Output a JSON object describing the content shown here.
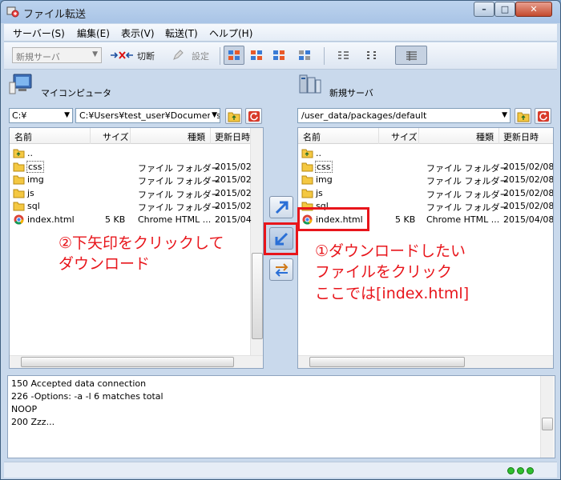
{
  "window": {
    "title": "ファイル転送"
  },
  "menu": [
    "サーバー(S)",
    "編集(E)",
    "表示(V)",
    "転送(T)",
    "ヘルプ(H)"
  ],
  "toolbar": {
    "server_select": "新規サーバ",
    "disconnect": "切断",
    "settings": "設定"
  },
  "local": {
    "label": "マイコンピュータ",
    "drive": "C:¥",
    "path": "C:¥Users¥test_user¥Documents",
    "columns": [
      "名前",
      "サイズ",
      "種類",
      "更新日時"
    ],
    "files": [
      {
        "name": "..",
        "size": "",
        "type": "",
        "date": "",
        "icon": "up-folder-icon"
      },
      {
        "name": "css",
        "size": "",
        "type": "ファイル フォルダー",
        "date": "2015/02",
        "icon": "folder-icon"
      },
      {
        "name": "img",
        "size": "",
        "type": "ファイル フォルダー",
        "date": "2015/02",
        "icon": "folder-icon"
      },
      {
        "name": "js",
        "size": "",
        "type": "ファイル フォルダー",
        "date": "2015/02",
        "icon": "folder-icon"
      },
      {
        "name": "sql",
        "size": "",
        "type": "ファイル フォルダー",
        "date": "2015/02",
        "icon": "folder-icon"
      },
      {
        "name": "index.html",
        "size": "5 KB",
        "type": "Chrome HTML ...",
        "date": "2015/04",
        "icon": "chrome-file-icon"
      }
    ]
  },
  "remote": {
    "label": "新規サーバ",
    "path": "/user_data/packages/default",
    "columns": [
      "名前",
      "サイズ",
      "種類",
      "更新日時"
    ],
    "files": [
      {
        "name": "..",
        "size": "",
        "type": "",
        "date": "",
        "icon": "up-folder-icon"
      },
      {
        "name": "css",
        "size": "",
        "type": "ファイル フォルダー",
        "date": "2015/02/08",
        "icon": "folder-icon"
      },
      {
        "name": "img",
        "size": "",
        "type": "ファイル フォルダー",
        "date": "2015/02/08",
        "icon": "folder-icon"
      },
      {
        "name": "js",
        "size": "",
        "type": "ファイル フォルダー",
        "date": "2015/02/08",
        "icon": "folder-icon"
      },
      {
        "name": "sql",
        "size": "",
        "type": "ファイル フォルダー",
        "date": "2015/02/08",
        "icon": "folder-icon"
      },
      {
        "name": "index.html",
        "size": "5 KB",
        "type": "Chrome HTML ...",
        "date": "2015/04/08",
        "icon": "chrome-file-icon"
      }
    ]
  },
  "log": [
    "150  Accepted data connection",
    "226 -Options: -a -l  6 matches total",
    "NOOP",
    "200  Zzz..."
  ],
  "annotations": {
    "left": [
      "②下矢印をクリックして",
      "ダウンロード"
    ],
    "right": [
      "①ダウンロードしたい",
      "ファイルをクリック",
      "ここでは[index.html]"
    ]
  },
  "colors": {
    "annotation": "#e8151b",
    "status_ok": "#2fbf2f"
  }
}
